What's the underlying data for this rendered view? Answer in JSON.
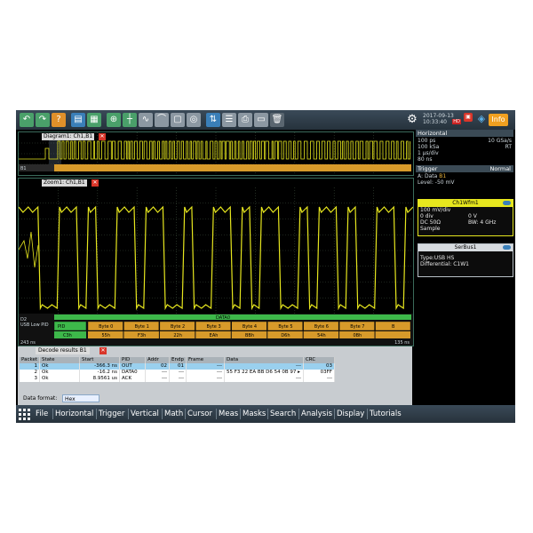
{
  "toolbar": {
    "date": "2017-09-13",
    "time": "10:33:40",
    "hd_badge": "HD",
    "info_label": "Info",
    "icons": [
      "undo-icon",
      "redo-icon",
      "help-icon",
      "folder-icon",
      "save-icon",
      "zoom-icon",
      "cursor-icon",
      "wave-icon",
      "measure-icon",
      "mask-icon",
      "search-icon",
      "autoset-icon",
      "print-icon",
      "delete-icon",
      "gear-icon",
      "network-icon"
    ]
  },
  "diagram": {
    "label": "Diagram1: Ch1,B1",
    "close": "✕"
  },
  "zoom": {
    "label": "Zoom1: Ch1,B1",
    "close": "✕",
    "usb_left_label": "USB Low PID",
    "bus_header": "DATA0",
    "bytes": [
      {
        "name": "Byte 0",
        "value": "55h"
      },
      {
        "name": "Byte 1",
        "value": "F3h"
      },
      {
        "name": "Byte 2",
        "value": "22h"
      },
      {
        "name": "Byte 3",
        "value": "EAh"
      },
      {
        "name": "Byte 4",
        "value": "BBh"
      },
      {
        "name": "Byte 5",
        "value": "D6h"
      },
      {
        "name": "Byte 6",
        "value": "54h"
      },
      {
        "name": "Byte 7",
        "value": "0Bh"
      },
      {
        "name": "B",
        "value": ""
      }
    ],
    "pid_value": "C3h",
    "time_left": "243 ns",
    "time_right": "135 ns",
    "ch_left": "B1",
    "ch_left_top": "D2",
    "diag_left": "B1"
  },
  "horizontal": {
    "title": "Horizontal",
    "rows": [
      {
        "left": "100 ps",
        "right": "10 GSa/s"
      },
      {
        "left": "100 kSa",
        "right": "RT"
      },
      {
        "left": "1 μs/div",
        "right": ""
      },
      {
        "left": "80 ns",
        "right": ""
      }
    ]
  },
  "trigger": {
    "title": "Trigger",
    "mode": "Normal",
    "rows": [
      {
        "left": "A:",
        "mid": "Data",
        "right": "B1"
      },
      {
        "left": "Level:",
        "mid": "-50 mV",
        "right": ""
      }
    ]
  },
  "ch1": {
    "title": "Ch1Wfm1",
    "lines": [
      {
        "left": "100 mV/div",
        "right": ""
      },
      {
        "left": "0 div",
        "right": "0 V"
      },
      {
        "left": "DC 50Ω",
        "right": "BW: 4 GHz"
      },
      {
        "left": "Sample",
        "right": ""
      }
    ]
  },
  "serbus": {
    "title": "SerBus1",
    "lines": [
      "Type:USB HS",
      "Differential: C1W1"
    ]
  },
  "decode": {
    "title": "Decode results B1",
    "close": "✕",
    "headers": [
      "Packet",
      "State",
      "Start",
      "PID",
      "Addr",
      "Endp",
      "Frame",
      "Data",
      "CRC"
    ],
    "rows": [
      {
        "packet": "1",
        "state": "Ok",
        "start": "-366.3 ns",
        "pid": "OUT",
        "addr": "02",
        "endp": "01",
        "frame": "---",
        "data": "---",
        "crc": "03",
        "selected": true
      },
      {
        "packet": "2",
        "state": "Ok",
        "start": "-16.2 ns",
        "pid": "DATA0",
        "addr": "---",
        "endp": "---",
        "frame": "---",
        "data": "55 F3 22 EA BB D6 54 0B 97 ▸",
        "crc": "03FF",
        "selected": false
      },
      {
        "packet": "3",
        "state": "Ok",
        "start": "8.9561 us",
        "pid": "ACK",
        "addr": "---",
        "endp": "---",
        "frame": "---",
        "data": "---",
        "crc": "---",
        "selected": false
      }
    ],
    "format_label": "Data format:",
    "format_value": "Hex"
  },
  "menu": [
    "File",
    "Horizontal",
    "Trigger",
    "Vertical",
    "Math",
    "Cursor",
    "Meas",
    "Masks",
    "Search",
    "Analysis",
    "Display",
    "Tutorials"
  ],
  "colors": {
    "trace": "#e6e61e",
    "bus": "#d79a2a",
    "pid": "#3db84a",
    "grid": "#3a4a3a",
    "panel": "#3b4a55"
  }
}
